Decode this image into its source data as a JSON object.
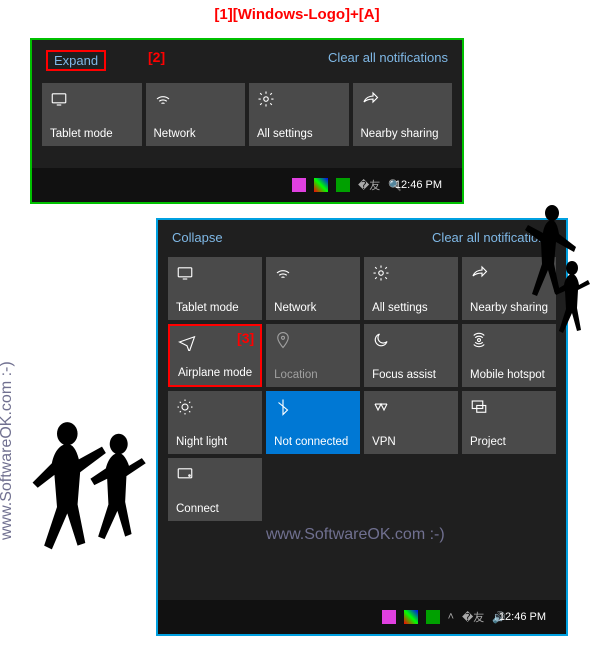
{
  "annotations": {
    "top": "[1][Windows-Logo]+[A]",
    "a2": "[2]",
    "a3": "[3]"
  },
  "panel1": {
    "toggle_label": "Expand",
    "clear_label": "Clear all notifications",
    "tiles": {
      "tablet": "Tablet mode",
      "network": "Network",
      "settings": "All settings",
      "nearby": "Nearby sharing"
    },
    "clock": "12:46 PM"
  },
  "panel2": {
    "toggle_label": "Collapse",
    "clear_label": "Clear all notifications",
    "tiles": {
      "tablet": "Tablet mode",
      "network": "Network",
      "settings": "All settings",
      "nearby": "Nearby sharing",
      "airplane": "Airplane mode",
      "location": "Location",
      "focus": "Focus assist",
      "hotspot": "Mobile hotspot",
      "nightlight": "Night light",
      "bluetooth": "Not connected",
      "vpn": "VPN",
      "project": "Project",
      "connect": "Connect"
    },
    "clock": "12:46 PM"
  },
  "watermark": "www.SoftwareOK.com :-)"
}
